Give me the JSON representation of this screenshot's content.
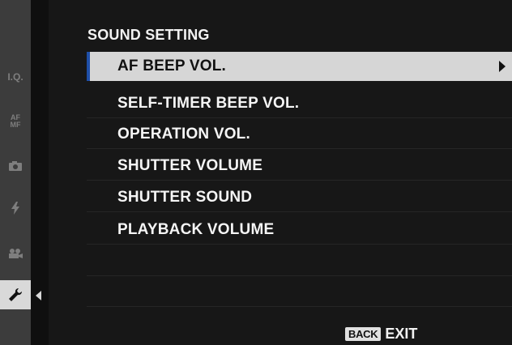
{
  "menu": {
    "title": "SOUND SETTING",
    "items": [
      {
        "label": "AF BEEP VOL."
      },
      {
        "label": "SELF-TIMER BEEP VOL."
      },
      {
        "label": "OPERATION VOL."
      },
      {
        "label": "SHUTTER VOLUME"
      },
      {
        "label": "SHUTTER SOUND"
      },
      {
        "label": "PLAYBACK VOLUME"
      }
    ],
    "selected_index": 0
  },
  "sidebar": {
    "tabs": [
      {
        "label": "I.Q.",
        "icon": "image-quality-icon"
      },
      {
        "label": "AF MF",
        "icon": "af-mf-icon"
      },
      {
        "label": "",
        "icon": "camera-icon"
      },
      {
        "label": "",
        "icon": "flash-icon"
      },
      {
        "label": "",
        "icon": "movie-icon"
      },
      {
        "label": "",
        "icon": "wrench-icon"
      }
    ],
    "active_index": 5
  },
  "footer": {
    "back_key": "BACK",
    "exit_label": "EXIT"
  },
  "colors": {
    "background": "#171717",
    "highlight": "#d6d6d6",
    "selection_marker": "#1f4fa8",
    "sidebar": "#3c3c3c"
  }
}
